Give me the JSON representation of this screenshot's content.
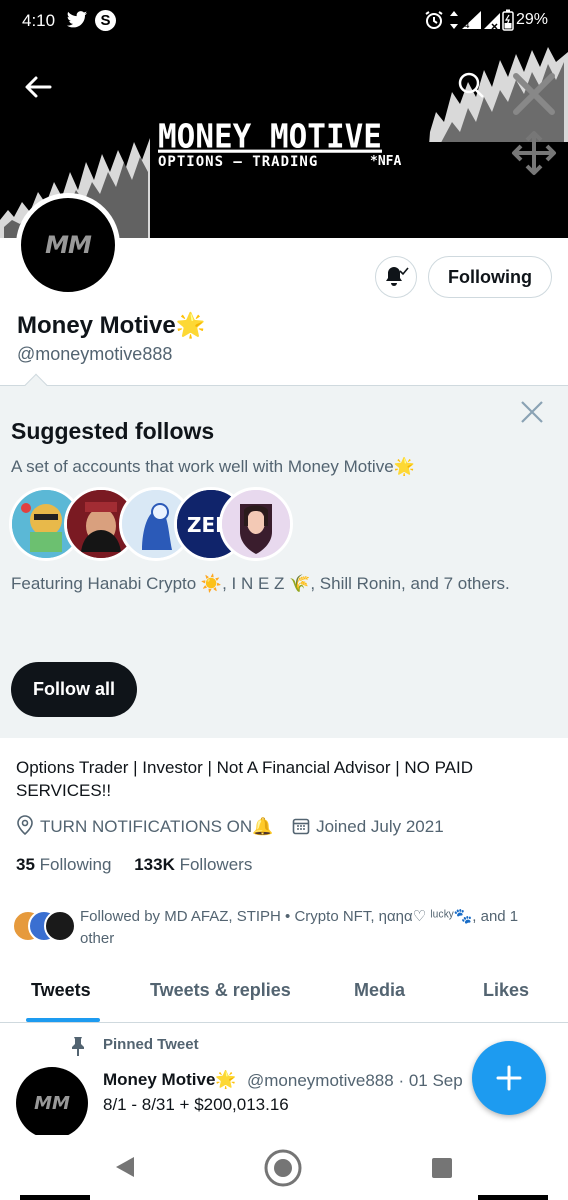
{
  "status_bar": {
    "time": "4:10",
    "battery": "29%"
  },
  "banner": {
    "title": "MONEY MOTIVE",
    "subtitle": "OPTIONS — TRADING",
    "nfa": "*NFA"
  },
  "profile": {
    "avatar_text": "MM",
    "display_name": "Money Motive",
    "handle": "@moneymotive888",
    "following_button": "Following",
    "bio": "Options Trader | Investor | Not A Financial Advisor | NO PAID SERVICES!!",
    "location": "TURN NOTIFICATIONS ON🔔",
    "joined": "Joined July 2021",
    "following_count": "35",
    "following_label": "Following",
    "followers_count": "133K",
    "followers_label": "Followers",
    "followed_by": "Followed by MD AFAZ, STIPH • Crypto NFT, ηαηα♡ ˡᵘᶜᵏʸ🐾, and 1 other"
  },
  "suggested": {
    "title": "Suggested follows",
    "description": "A set of accounts that work well with Money Motive🌟",
    "featuring": "Featuring Hanabi Crypto ☀️, I N E Z 🌾, Shill Ronin, and 7 others.",
    "follow_all": "Follow all",
    "avatar_colors": [
      "#5bb8d6",
      "#7a1a22",
      "#d9e8f5",
      "#10246b",
      "#e8d9ee"
    ]
  },
  "tabs": [
    {
      "label": "Tweets",
      "active": true
    },
    {
      "label": "Tweets & replies",
      "active": false
    },
    {
      "label": "Media",
      "active": false
    },
    {
      "label": "Likes",
      "active": false
    }
  ],
  "pinned_tweet": {
    "pinned_label": "Pinned Tweet",
    "name": "Money Motive",
    "handle_date": "@moneymotive888 · 01 Sep",
    "text": "8/1 - 8/31 + $200,013.16",
    "avatar_text": "MM"
  },
  "colors": {
    "accent": "#1d9bf0",
    "text_primary": "#0f1419",
    "text_secondary": "#536471",
    "suggested_bg": "#eff3f4"
  }
}
